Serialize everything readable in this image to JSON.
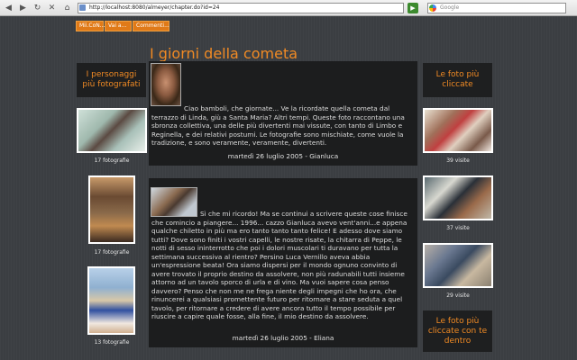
{
  "browser": {
    "url": "http://localhost:8080/almeyer/chapter.do?id=24",
    "search_placeholder": "Google",
    "go_label": "▶"
  },
  "nav": {
    "items": [
      "Mii.CoN...",
      "Vai a...",
      "Commenti..."
    ]
  },
  "page": {
    "title": "I giorni della cometa"
  },
  "left_sidebar": {
    "heading": "I personaggi più fotografati",
    "items": [
      {
        "caption": "17 fotografie"
      },
      {
        "caption": "17 fotografie"
      },
      {
        "caption": "13 fotografie"
      }
    ]
  },
  "right_sidebar": {
    "heading": "Le foto più cliccate",
    "items": [
      {
        "caption": "39 visite"
      },
      {
        "caption": "37 visite"
      },
      {
        "caption": "29 visite"
      }
    ],
    "heading2": "Le foto più cliccate con te dentro"
  },
  "posts": [
    {
      "text": "Ciao bamboli, che giornate... Ve la ricordate quella cometa dal terrazzo di Linda, giù a Santa Maria? Altri tempi. Queste foto raccontano una sbronza collettiva, una delle più divertenti mai vissute, con tanto di Limbo e Reginella, e dei relativi postumi. Le fotografie sono mischiate, come vuole la tradizione, e sono veramente, veramente, divertenti.",
      "footer": "martedì 26 luglio 2005 - Gianluca"
    },
    {
      "text": "Sì che mi ricordo! Ma se continui a scrivere queste cose finisce che comincio a piangere... 1996... cazzo Gianluca avevo vent'anni...e appena qualche chiletto in più ma ero tanto tanto tanto felice! E adesso dove siamo tutti? Dove sono finiti i vostri capelli, le nostre risate, la chitarra di Peppe, le notti di sesso ininterrotto che poi i dolori muscolari ti duravano per tutta la settimana successiva al rientro? Persino Luca Vernillo aveva abbia un'espressione beata! Ora siamo dispersi per il mondo ognuno convinto di avere trovato il proprio destino da assolvere, non più radunabili tutti insieme attorno ad un tavolo sporco di urla e di vino. Ma vuoi sapere cosa penso davvero? Penso che non me ne frega niente degli impegni che ho ora, che rinuncerei a qualsiasi promettente futuro per ritornare a stare seduta a quel tavolo, per ritornare a credere di avere ancora tutto il tempo possibile per riuscire a capire quale fosse, alla fine, il mio destino da assolvere.",
      "footer": "martedì 26 luglio 2005 - Eliana"
    }
  ],
  "colors": {
    "accent": "#f08a24",
    "nav_bg": "#e07a18",
    "page_bg": "#3b3e42",
    "panel_bg": "#1c1d1e"
  }
}
